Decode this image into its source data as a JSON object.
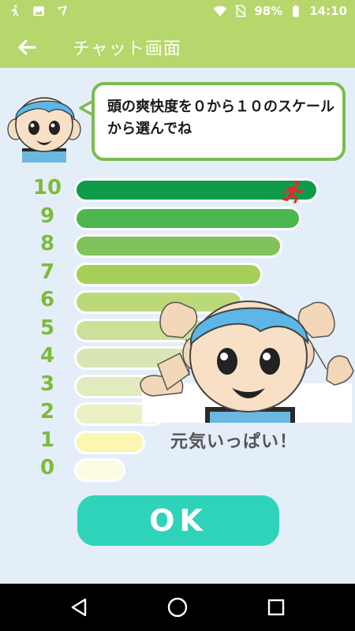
{
  "status_bar": {
    "battery": "98%",
    "time": "14:10",
    "icons": [
      "walk-icon",
      "image-icon",
      "cast-icon",
      "wifi-icon",
      "no-sim-icon",
      "battery-icon"
    ]
  },
  "app_bar": {
    "title": "チャット画面",
    "back_icon": "arrow-left-icon"
  },
  "bubble": {
    "text": "頭の爽快度を０から１０のスケールから選んでね"
  },
  "scale": [
    {
      "label": "10",
      "fill": 1.0,
      "color": "#0f9a4a",
      "selected": true
    },
    {
      "label": "9",
      "fill": 0.93,
      "color": "#4cb74f",
      "selected": false
    },
    {
      "label": "8",
      "fill": 0.85,
      "color": "#82c25a",
      "selected": false
    },
    {
      "label": "7",
      "fill": 0.77,
      "color": "#a7cf57",
      "selected": false
    },
    {
      "label": "6",
      "fill": 0.69,
      "color": "#bcd97a",
      "selected": false
    },
    {
      "label": "5",
      "fill": 0.61,
      "color": "#cbe19a",
      "selected": false
    },
    {
      "label": "4",
      "fill": 0.53,
      "color": "#d8e6b6",
      "selected": false
    },
    {
      "label": "3",
      "fill": 0.45,
      "color": "#e2ebbd",
      "selected": false
    },
    {
      "label": "2",
      "fill": 0.37,
      "color": "#eaf1c4",
      "selected": false
    },
    {
      "label": "1",
      "fill": 0.29,
      "color": "#fbf6b0",
      "selected": false
    },
    {
      "label": "0",
      "fill": 0.21,
      "color": "#fdfbe0",
      "selected": false
    }
  ],
  "selected_icon": "runner-icon",
  "caption": "元気いっぱい！",
  "ok_button": {
    "label": "OK"
  },
  "nav": {
    "back": "nav-back-icon",
    "home": "nav-home-icon",
    "recents": "nav-recents-icon"
  }
}
